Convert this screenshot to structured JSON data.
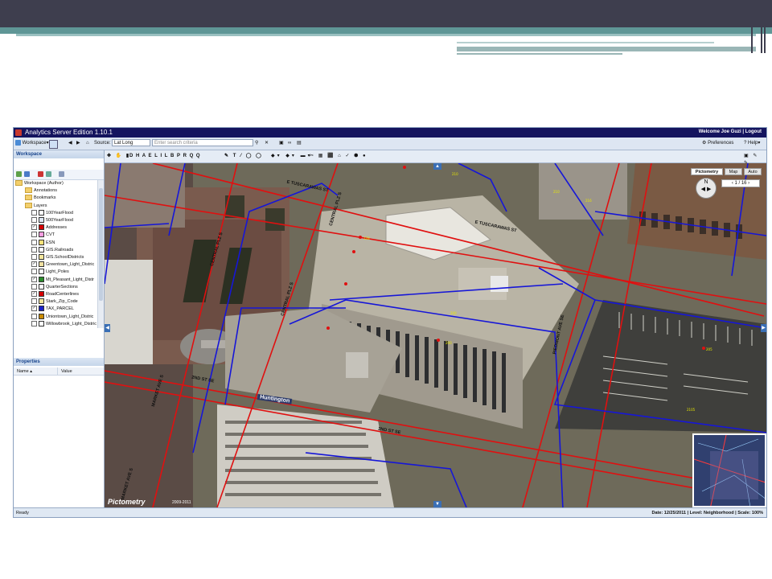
{
  "app": {
    "title": "Analytics Server Edition 1.10.1",
    "welcome": "Welcome Joe Guzi | Logout"
  },
  "toolbar": {
    "workspace_label": "Workspace",
    "source_label": "Source:",
    "source_value": "Lat Long",
    "search_placeholder": "Enter search criteria",
    "preferences_label": "Preferences",
    "help_label": "Help"
  },
  "workspace_panel": {
    "title": "Workspace",
    "tree": [
      {
        "label": "Workspace (Author)",
        "kind": "folder",
        "level": 0
      },
      {
        "label": "Annotations",
        "kind": "folder",
        "level": 1
      },
      {
        "label": "Bookmarks",
        "kind": "folder",
        "level": 1
      },
      {
        "label": "Layers",
        "kind": "folder",
        "level": 1
      },
      {
        "label": "100YearFlood",
        "kind": "layer",
        "checked": false,
        "color": "#ffffff"
      },
      {
        "label": "500YearFlood",
        "kind": "layer",
        "checked": false,
        "color": "#dde6f2"
      },
      {
        "label": "Addresses",
        "kind": "layer",
        "checked": true,
        "color": "#d40000"
      },
      {
        "label": "CVT",
        "kind": "layer",
        "checked": false,
        "color": "#ff9de0"
      },
      {
        "label": "ESN",
        "kind": "layer",
        "checked": false,
        "color": "#ffe27a"
      },
      {
        "label": "GIS.Railroads",
        "kind": "layer",
        "checked": false,
        "color": "#ffffff"
      },
      {
        "label": "GIS.SchoolDistricts",
        "kind": "layer",
        "checked": false,
        "color": "#f4e79c"
      },
      {
        "label": "Greentown_Light_Distric",
        "kind": "layer",
        "checked": true,
        "color": "#f0e0a0"
      },
      {
        "label": "Light_Poles",
        "kind": "layer",
        "checked": false,
        "color": "#ffffff"
      },
      {
        "label": "Mt_Pleasant_Light_Distr",
        "kind": "layer",
        "checked": true,
        "color": "#2b8b2b"
      },
      {
        "label": "QuarterSections",
        "kind": "layer",
        "checked": false,
        "color": "#ffffff"
      },
      {
        "label": "RoadCenterlines",
        "kind": "layer",
        "checked": true,
        "color": "#d40000"
      },
      {
        "label": "Stark_Zip_Code",
        "kind": "layer",
        "checked": false,
        "color": "#f4e79c"
      },
      {
        "label": "TAX_PARCEL",
        "kind": "layer",
        "checked": true,
        "color": "#1a22c8"
      },
      {
        "label": "Uniontown_Light_Distric",
        "kind": "layer",
        "checked": false,
        "color": "#c98a00"
      },
      {
        "label": "Willowbrook_Light_Distric",
        "kind": "layer",
        "checked": false,
        "color": "#ffffff"
      }
    ]
  },
  "properties_panel": {
    "title": "Properties",
    "col_name": "Name",
    "col_value": "Value"
  },
  "map": {
    "street_labels": [
      "E TUSCARAWAS ST",
      "E TUSCARAWAS ST",
      "CENTRAL PLZ S",
      "CENTRAL PLZ S",
      "CENTRAL PLZ S",
      "2ND ST SE",
      "2ND ST SE",
      "MARKET AVE S",
      "MARKET AVE S",
      "PIEDMONT AVE SE"
    ],
    "building_sign": "Huntington",
    "pictometry": {
      "tab_pictometry": "Pictometry",
      "tab_map": "Map",
      "tab_auto": "Auto",
      "page": "1 / 16"
    },
    "watermark": "Pictometry",
    "watermark_year": "2009-2011"
  },
  "status": {
    "left": "Ready",
    "right": "Date: 12/25/2011 | Level: Neighborhood | Scale: 100%"
  }
}
